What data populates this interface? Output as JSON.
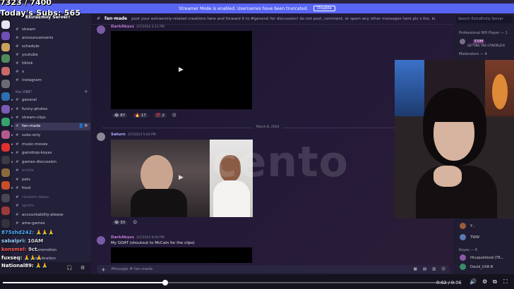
{
  "overlay": {
    "subs_title": "Today's Subs: 565",
    "subs_count": "7323 / 7400"
  },
  "banner": {
    "text": "Streamer Mode is enabled. Usernames have been truncated.",
    "dismiss": "Disable"
  },
  "server": {
    "name": "ExtraEmily Server!",
    "category_chill": "the VIBE!",
    "channels_top": [
      {
        "name": "stream"
      },
      {
        "name": "announcements"
      },
      {
        "name": "schedule"
      },
      {
        "name": "youtube"
      },
      {
        "name": "tiktok"
      },
      {
        "name": "x"
      },
      {
        "name": "instagram"
      }
    ],
    "channels": [
      {
        "name": "general"
      },
      {
        "name": "funny-photos"
      },
      {
        "name": "stream-clips"
      },
      {
        "name": "fan-made"
      },
      {
        "name": "subs-only"
      },
      {
        "name": "music-moves"
      },
      {
        "name": "gamdrop-koyas"
      },
      {
        "name": "games-discussion"
      },
      {
        "name": "emilie"
      },
      {
        "name": "pets"
      },
      {
        "name": "food"
      },
      {
        "name": "random-ideas"
      },
      {
        "name": "sports"
      },
      {
        "name": "accountability-please"
      },
      {
        "name": "ame-games"
      },
      {
        "name": "promotion"
      },
      {
        "name": "celebration"
      }
    ]
  },
  "chat": {
    "channel_title": "fan-made",
    "topic": "post your extraemily-related creations here and forward it to #general for discussion! do not post, comment, or spam any other messages here pls x thx. keep all other content e...",
    "date_divider": "March 8, 2024",
    "messages": [
      {
        "user": "DarkAbyss",
        "time": "3/7/2024 3:11 PM",
        "reactions": [
          "87",
          "17",
          "2"
        ]
      },
      {
        "user": "Saturn",
        "time": "3/7/2024 5:44 PM",
        "reactions": [
          "33"
        ]
      },
      {
        "user": "DarkAbyss",
        "time": "3/7/2024 9:00 PM",
        "text": "My GOAT (shoutout to McCain for the clips)"
      }
    ],
    "composer_placeholder": "Message # fan-made"
  },
  "members": {
    "search_placeholder": "Search ExtraEmily Server",
    "categories": [
      "Professional WH Player — 1",
      "Moderators — 4",
      "Koyas — 6"
    ],
    "member_tags": [
      "EXIM",
      "GETTING THE GTWORLD B",
      "Y...",
      "TWW",
      "Ithuquietiosd (76...",
      "David_UVA B"
    ]
  },
  "stream_chat": [
    {
      "user": "875shd242:",
      "text": "🙏🙏🙏",
      "color": "#4fb2ff"
    },
    {
      "user": "sabalpri:",
      "text": "10AM",
      "color": "#ffffff"
    },
    {
      "user": "konsmel:",
      "text": "9ct",
      "color": "#ff5c5c"
    },
    {
      "user": "fuxseq:",
      "text": "🙏🙏🙏",
      "color": "#ffffff"
    },
    {
      "user": "National89:",
      "text": "🙏🙏",
      "color": "#ffffff"
    }
  ],
  "watermark": "cento",
  "player": {
    "time": "0:02 / 0:06",
    "progress": 0.36
  }
}
